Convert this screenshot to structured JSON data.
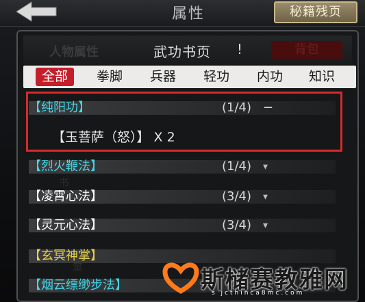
{
  "header": {
    "title": "属性",
    "manual_button": "秘籍残页"
  },
  "dialog": {
    "tab_attributes": "人物属性",
    "title": "武功书页",
    "title_mark": "!",
    "tab_bag": "背包"
  },
  "categories": [
    "全部",
    "拳脚",
    "兵器",
    "轻功",
    "内功",
    "知识"
  ],
  "active_category": "全部",
  "skills": [
    {
      "name": "【纯阳功】",
      "progress": "(1/4)",
      "color": "#42d7e8",
      "expanded": true
    },
    {
      "name": "【烈火鞭法】",
      "progress": "(1/4)",
      "color": "#42d7e8",
      "expanded": false
    },
    {
      "name": "【凌霄心法】",
      "progress": "(3/4)",
      "color": "#ffffff",
      "expanded": false
    },
    {
      "name": "【灵元心法】",
      "progress": "(3/4)",
      "color": "#ffffff",
      "expanded": false
    },
    {
      "name": "【玄冥神掌】",
      "progress": "",
      "color": "#e8d34a",
      "expanded": false
    },
    {
      "name": "【烟云缥缈步法】",
      "progress": "",
      "color": "#42d7e8",
      "expanded": false
    }
  ],
  "sub_item": "【玉菩萨（怒）】 X 2",
  "icons": {
    "back": "back-arrow-icon",
    "expanded": "dash-icon",
    "collapsed": "chevron-down-icon"
  },
  "colors": {
    "accent_red": "#c41e2a",
    "highlight_box": "#d62a2a",
    "cyan_name": "#42d7e8",
    "yellow_name": "#e8d34a"
  },
  "watermark": {
    "text": "斯槠赛教雅网",
    "url": "s jcthinca8mc.com"
  }
}
